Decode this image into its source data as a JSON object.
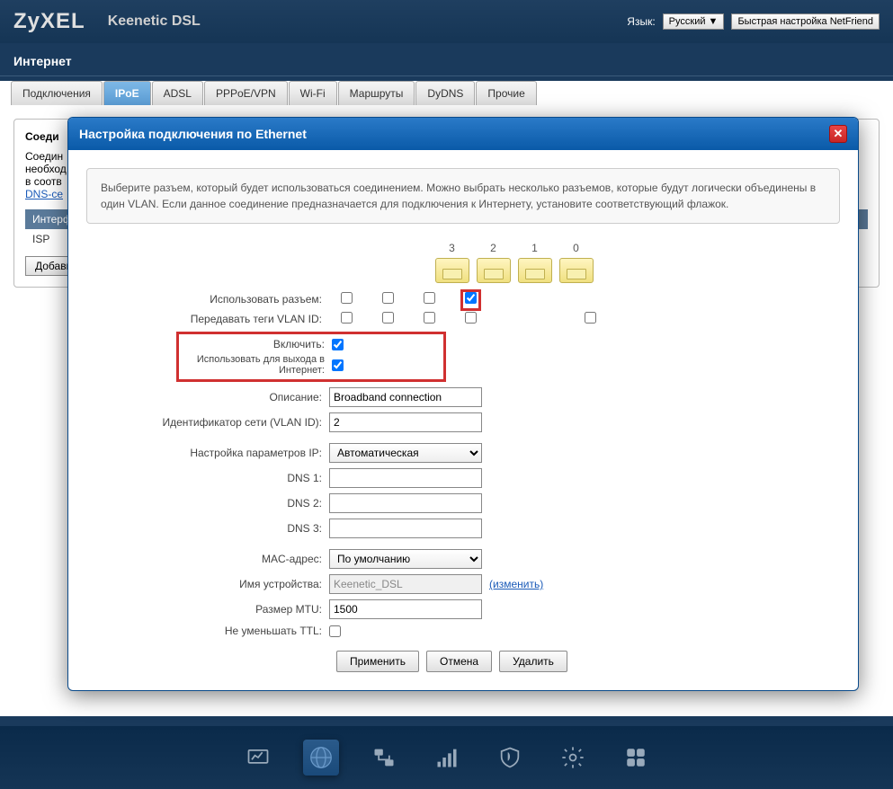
{
  "header": {
    "logo": "ZyXEL",
    "product": "Keenetic DSL",
    "lang_label": "Язык:",
    "lang_value": "Русский",
    "quick_setup": "Быстрая настройка NetFriend"
  },
  "section_title": "Интернет",
  "tabs": [
    "Подключения",
    "IPoE",
    "ADSL",
    "PPPoE/VPN",
    "Wi-Fi",
    "Маршруты",
    "DyDNS",
    "Прочие"
  ],
  "active_tab": 1,
  "bg_fieldset_title": "Соеди",
  "bg_text1": "Соедин",
  "bg_text2": "необход",
  "bg_text3": "в соотв",
  "bg_link": "DNS-се",
  "bg_col": "Интерф",
  "bg_row": "ISP",
  "bg_add": "Добави",
  "modal": {
    "title": "Настройка подключения по Ethernet",
    "info": "Выберите разъем, который будет использоваться соединением. Можно выбрать несколько разъемов, которые будут логически объединены в один VLAN. Если данное соединение предназначается для подключения к Интернету, установите соответствующий флажок.",
    "ports": [
      "3",
      "2",
      "1",
      "0"
    ],
    "labels": {
      "use_port": "Использовать разъем:",
      "vlan_tag": "Передавать теги VLAN ID:",
      "enable": "Включить:",
      "use_internet": "Использовать для выхода в Интернет:",
      "description": "Описание:",
      "vlan_id": "Идентификатор сети (VLAN ID):",
      "ip_config": "Настройка параметров IP:",
      "dns1": "DNS 1:",
      "dns2": "DNS 2:",
      "dns3": "DNS 3:",
      "mac": "MAC-адрес:",
      "device_name": "Имя устройства:",
      "mtu": "Размер MTU:",
      "ttl": "Не уменьшать TTL:"
    },
    "values": {
      "use_port": [
        false,
        false,
        false,
        true
      ],
      "vlan_tag": [
        false,
        false,
        false,
        false
      ],
      "vlan_extra": false,
      "enable": true,
      "use_internet": true,
      "description": "Broadband connection",
      "vlan_id": "2",
      "ip_config": "Автоматическая",
      "dns1": "",
      "dns2": "",
      "dns3": "",
      "mac": "По умолчанию",
      "device_name": "Keenetic_DSL",
      "change_link": "(изменить)",
      "mtu": "1500",
      "ttl": false
    },
    "buttons": {
      "apply": "Применить",
      "cancel": "Отмена",
      "delete": "Удалить"
    }
  }
}
